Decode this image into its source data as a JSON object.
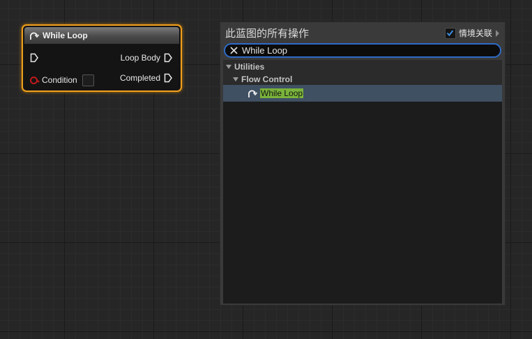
{
  "node": {
    "title": "While Loop",
    "icon": "loop-icon",
    "pins": {
      "exec_in": "exec-in-pin",
      "loop_body": "Loop Body",
      "condition": "Condition",
      "completed": "Completed"
    },
    "colors": {
      "border": "#f0a020",
      "bool_pin": "#c01a1a"
    }
  },
  "menu": {
    "title": "此蓝图的所有操作",
    "context_sensitive": {
      "label": "情境关联",
      "checked": true
    },
    "search": {
      "value": "While Loop",
      "clear_icon": "close-icon"
    },
    "tree": [
      {
        "label": "Utilities",
        "level": 0
      },
      {
        "label": "Flow Control",
        "level": 1
      },
      {
        "label": "While Loop",
        "level": 2,
        "selected": true,
        "icon": "loop-icon"
      }
    ],
    "colors": {
      "search_border": "#2d6bc8",
      "selected_row": "#3f5063",
      "highlight": "#7ab33b",
      "checkbox_check": "#3b8fe6"
    }
  }
}
